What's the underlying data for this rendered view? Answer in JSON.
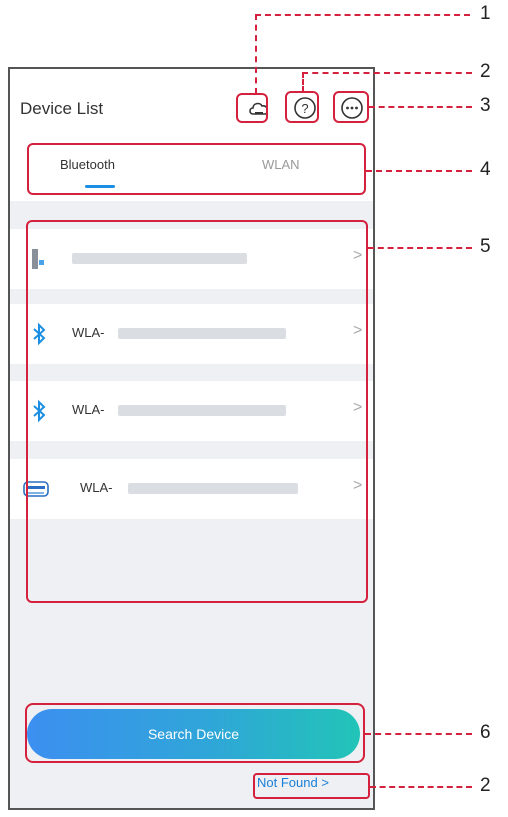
{
  "header": {
    "title": "Device List",
    "icons": [
      "cloud-icon",
      "help-icon",
      "more-icon"
    ]
  },
  "tabs": [
    {
      "label": "Bluetooth",
      "active": true
    },
    {
      "label": "WLAN",
      "active": false
    }
  ],
  "devices": [
    {
      "icon": "inverter-icon",
      "prefix": ""
    },
    {
      "icon": "bluetooth-icon",
      "prefix": "WLA-"
    },
    {
      "icon": "bluetooth-icon",
      "prefix": "WLA-"
    },
    {
      "icon": "router-icon",
      "prefix": "WLA-"
    }
  ],
  "chevron": ">",
  "search_button": "Search Device",
  "not_found": "Not Found >",
  "callouts": [
    "1",
    "2",
    "3",
    "4",
    "5",
    "6",
    "2"
  ],
  "colors": {
    "accent": "#1a8fe3",
    "callout": "#d4213d"
  }
}
